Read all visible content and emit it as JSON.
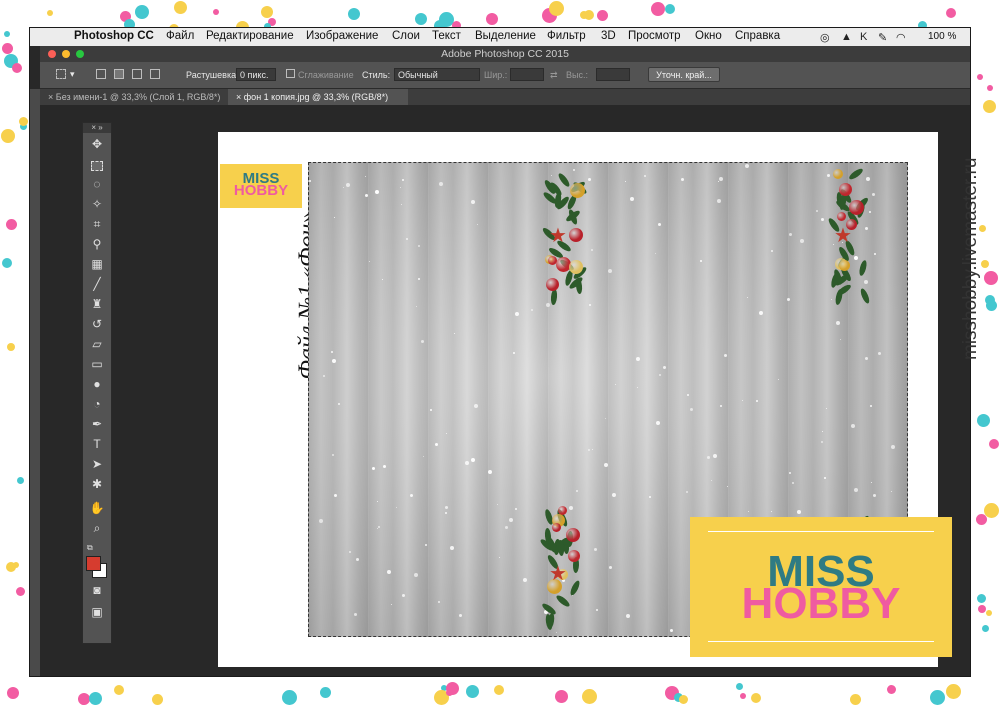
{
  "menubar": {
    "apple_glyph": "",
    "items": [
      "Photoshop CC",
      "Файл",
      "Редактирование",
      "Изображение",
      "Слои",
      "Текст",
      "Выделение",
      "Фильтр",
      "3D",
      "Просмотр",
      "Окно",
      "Справка"
    ],
    "battery": "100 %"
  },
  "window": {
    "title": "Adobe Photoshop CC 2015"
  },
  "options": {
    "feather_label": "Растушевка:",
    "feather_value": "0 пикс.",
    "antialias_label": "Сглаживание",
    "style_label": "Стиль:",
    "style_value": "Обычный",
    "width_label": "Шир.:",
    "height_label": "Выс.:",
    "refine_button": "Уточн. край..."
  },
  "tabs": [
    {
      "label": "Без имени-1 @ 33,3% (Слой 1, RGB/8*)"
    },
    {
      "label": "фон 1 копия.jpg @ 33,3% (RGB/8*)"
    }
  ],
  "document": {
    "side_text": "Файл №1 «Фон»",
    "logo_small": {
      "line1": "MISS",
      "line2": "HOBBY"
    }
  },
  "overlay_logo": {
    "line1": "MISS",
    "line2": "HOBBY"
  },
  "watermark": "misshobby.livemaster.ru",
  "colors": {
    "foreground": "#d63c2f",
    "background": "#ffffff",
    "logo_yellow": "#f7d04c",
    "logo_teal": "#2f7b83",
    "logo_pink": "#ef5ba1"
  }
}
